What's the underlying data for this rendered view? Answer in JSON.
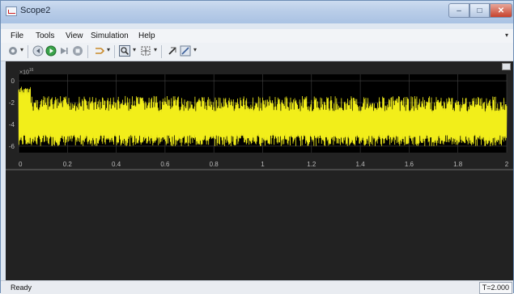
{
  "window": {
    "title": "Scope2"
  },
  "window_controls": {
    "minimize": "–",
    "maximize": "□",
    "close": "✕"
  },
  "menubar": {
    "items": [
      "File",
      "Tools",
      "View",
      "Simulation",
      "Help"
    ]
  },
  "toolbar": {
    "icons": [
      "settings-icon",
      "step-back-icon",
      "run-icon",
      "step-forward-icon",
      "stop-icon",
      "highlight-model-icon",
      "zoom-icon",
      "zoom-extents-icon",
      "cursor-measure-icon",
      "style-icon"
    ]
  },
  "plot": {
    "exponent_label": "×10",
    "exponent_power": "16",
    "y_tick_labels": [
      "0",
      "-2",
      "-4",
      "-6"
    ],
    "x_tick_labels": [
      "0",
      "0.2",
      "0.4",
      "0.6",
      "0.8",
      "1",
      "1.2",
      "1.4",
      "1.6",
      "1.8",
      "2"
    ],
    "trace_color": "#f2ee1a",
    "axes_background": "#000000",
    "grid_color": "#444444"
  },
  "chart_data": {
    "type": "line",
    "series": [
      {
        "values_description_free": true,
        "min": -6.2,
        "max": -0.6
      }
    ],
    "xlim": [
      0,
      2
    ],
    "ylim": [
      -6.6,
      0.6
    ],
    "xticks": [
      0,
      0.2,
      0.4,
      0.6,
      0.8,
      1,
      1.2,
      1.4,
      1.6,
      1.8,
      2
    ],
    "yticks": [
      0,
      -2,
      -4,
      -6
    ],
    "grid": true
  },
  "status": {
    "left": "Ready",
    "right": "T=2.000"
  }
}
